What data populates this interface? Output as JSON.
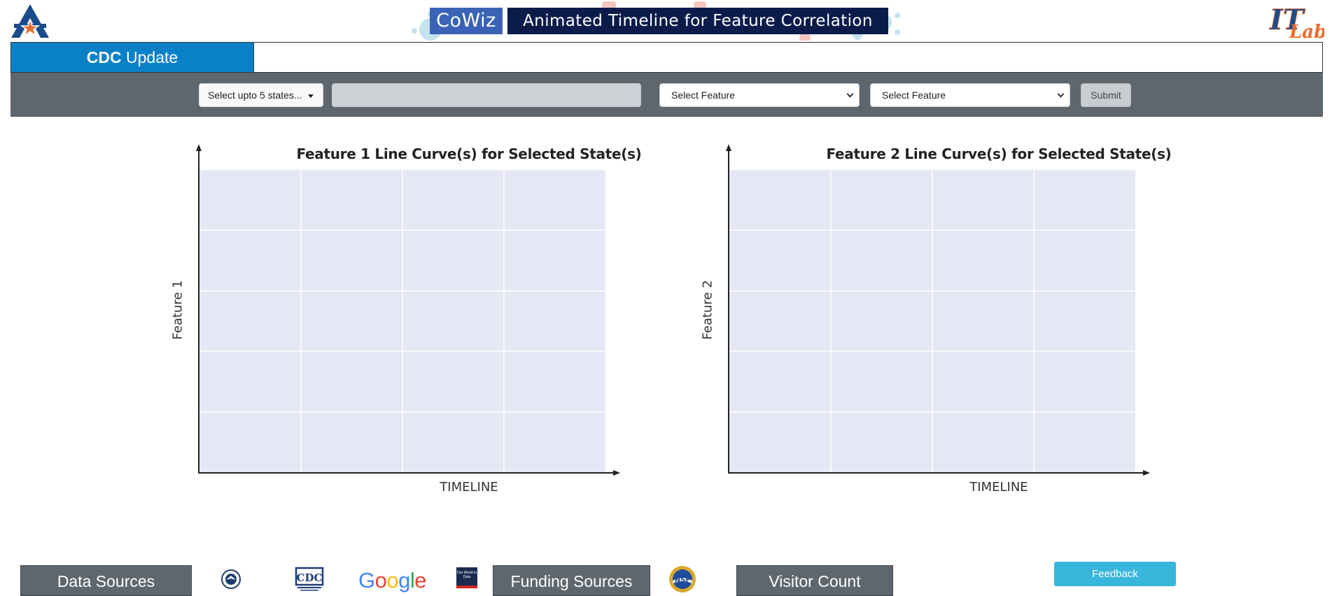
{
  "header": {
    "app_name": "CoWiz",
    "app_title": "Animated Timeline for Feature Correlation",
    "left_logo": "uta-a-star-logo",
    "right_logo": "it-lab-logo",
    "right_logo_text": "IT Lab"
  },
  "tabs": [
    {
      "label_bold": "CDC",
      "label_rest": " Update",
      "active": true
    }
  ],
  "controls": {
    "states_dropdown_label": "Select upto 5 states...",
    "date_input_value": "",
    "feature1_select_value": "Select Feature",
    "feature2_select_value": "Select Feature",
    "submit_label": "Submit"
  },
  "charts": [
    {
      "title": "Feature 1 Line Curve(s) for Selected State(s)",
      "xlabel": "TIMELINE",
      "ylabel": "Feature 1"
    },
    {
      "title": "Feature 2 Line Curve(s) for Selected State(s)",
      "xlabel": "TIMELINE",
      "ylabel": "Feature 2"
    }
  ],
  "chart_data": [
    {
      "type": "line",
      "title": "Feature 1 Line Curve(s) for Selected State(s)",
      "xlabel": "TIMELINE",
      "ylabel": "Feature 1",
      "series": [],
      "grid": true
    },
    {
      "type": "line",
      "title": "Feature 2 Line Curve(s) for Selected State(s)",
      "xlabel": "TIMELINE",
      "ylabel": "Feature 2",
      "series": [],
      "grid": true
    }
  ],
  "footer": {
    "data_sources_label": "Data Sources",
    "funding_sources_label": "Funding Sources",
    "visitor_count_label": "Visitor Count",
    "feedback_label": "Feedback",
    "cdc_logo_text": "CDC",
    "google_logo_text": "Google",
    "owid_logo_text": "Our World in Data",
    "nsf_logo_text": "NSF"
  },
  "colors": {
    "tab_active": "#0a81c7",
    "control_bar": "#5e676d",
    "app_name_bg": "#3a63b5",
    "app_title_bg": "#0b1c4b",
    "plot_bg": "#e6e7f4",
    "feedback": "#38b6dc"
  }
}
